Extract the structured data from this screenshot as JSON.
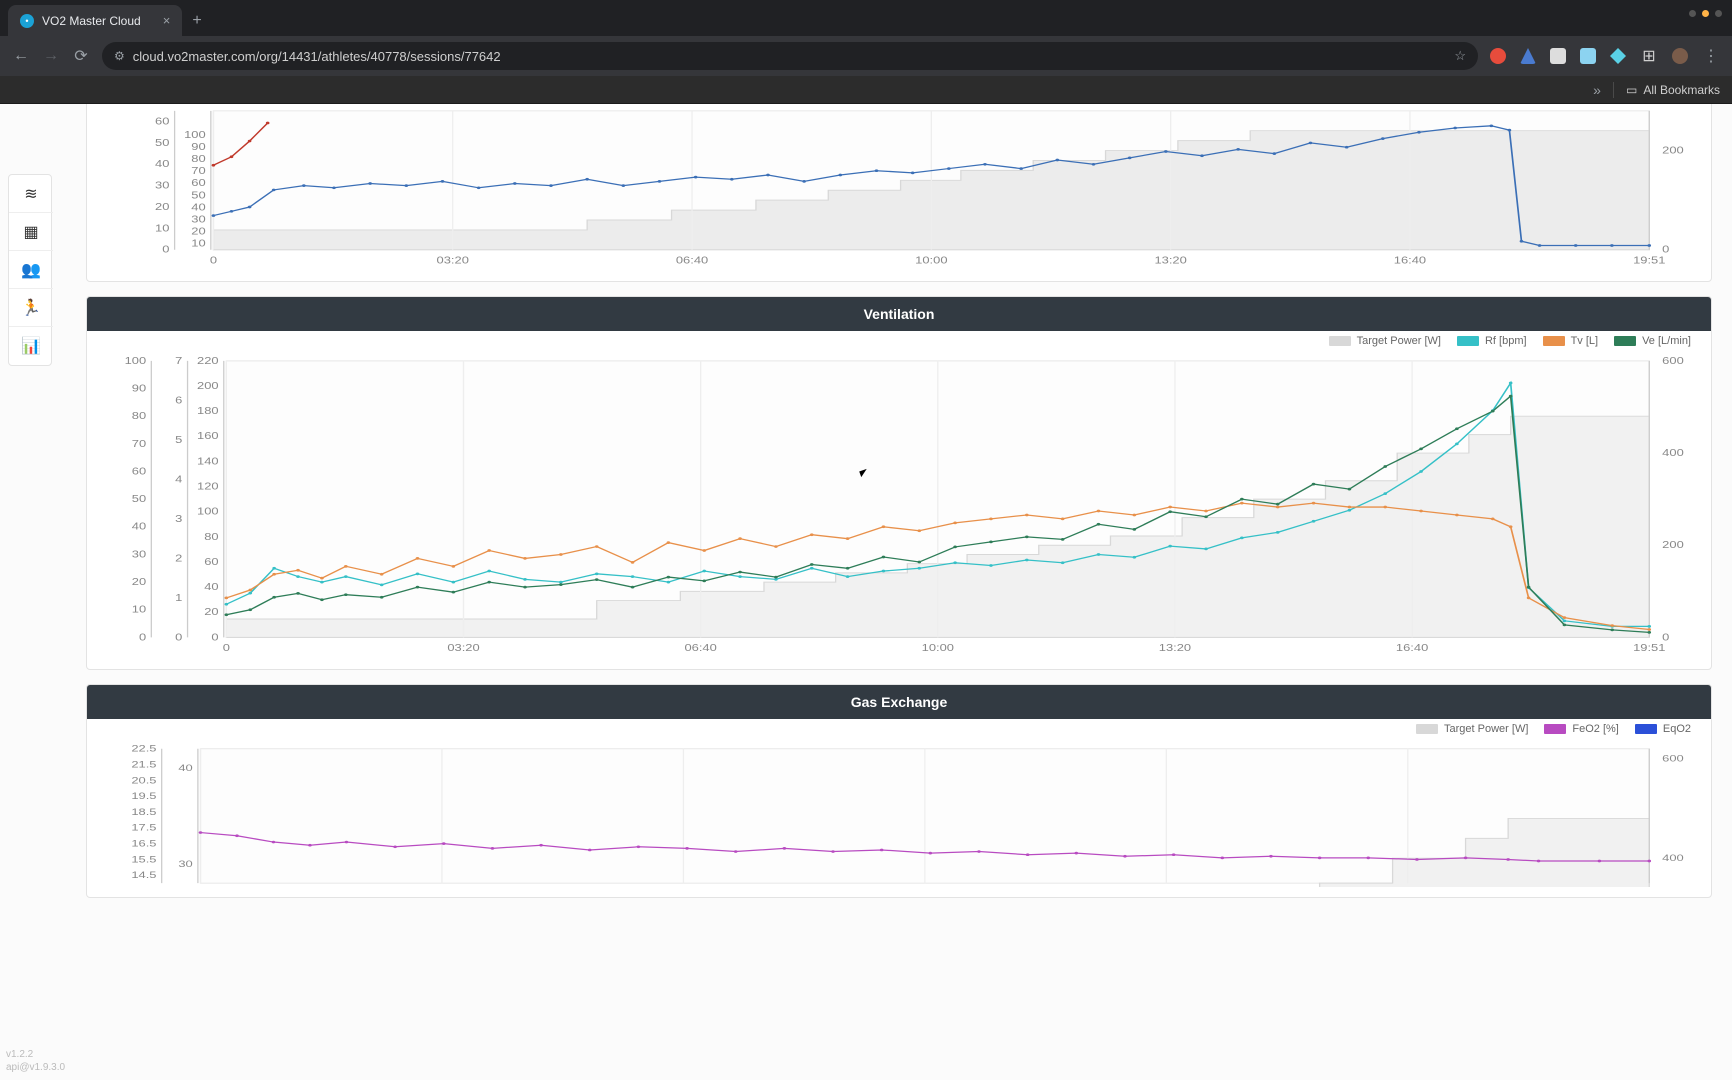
{
  "browser": {
    "tab_title": "VO2 Master Cloud",
    "url": "cloud.vo2master.com/org/14431/athletes/40778/sessions/77642",
    "bookmarks_label": "All Bookmarks"
  },
  "version": {
    "app": "v1.2.2",
    "api": "api@v1.9.3.0"
  },
  "sidebar_icons": [
    "layers",
    "grid",
    "group",
    "runner",
    "chart"
  ],
  "panels": [
    {
      "id": "top_cropped",
      "title": "",
      "legend": []
    },
    {
      "id": "ventilation",
      "title": "Ventilation",
      "legend": [
        {
          "label": "Target Power [W]",
          "color": "#d8d8d8"
        },
        {
          "label": "Rf [bpm]",
          "color": "#35c0c7"
        },
        {
          "label": "Tv [L]",
          "color": "#e8904a"
        },
        {
          "label": "Ve [L/min]",
          "color": "#2e7d58"
        }
      ]
    },
    {
      "id": "gas_exchange",
      "title": "Gas Exchange",
      "legend": [
        {
          "label": "Target Power [W]",
          "color": "#d8d8d8"
        },
        {
          "label": "FeO2 [%]",
          "color": "#b84bc1"
        },
        {
          "label": "EqO2",
          "color": "#2b50d8"
        }
      ]
    }
  ],
  "chart_data": [
    {
      "id": "top_cropped",
      "type": "line",
      "x_ticks": [
        "0",
        "03:20",
        "06:40",
        "10:00",
        "13:20",
        "16:40",
        "19:51"
      ],
      "x_range": [
        0,
        1191
      ],
      "axes": [
        {
          "side": "left",
          "color": "#c0392b",
          "ticks": [
            10,
            20,
            30,
            40,
            50,
            60,
            70,
            80,
            90,
            100
          ],
          "lim": [
            0,
            120
          ],
          "visible_lim": [
            5,
            120
          ]
        },
        {
          "side": "left2",
          "color": "#3b6fb6",
          "ticks": [
            0,
            10,
            20,
            30,
            40,
            50,
            60
          ],
          "lim": [
            0,
            70
          ],
          "visible_lim": [
            0,
            65
          ]
        },
        {
          "side": "right",
          "color": "#666",
          "ticks": [
            0,
            200
          ],
          "lim": [
            0,
            600
          ],
          "visible_lim": [
            0,
            280
          ]
        }
      ],
      "target_power": {
        "color": "#d8d8d8",
        "fill": "#ececec",
        "steps_x": [
          0,
          200,
          310,
          380,
          450,
          510,
          570,
          620,
          680,
          740,
          800,
          860,
          1080,
          1191
        ],
        "steps_y": [
          40,
          40,
          60,
          80,
          100,
          120,
          140,
          160,
          180,
          200,
          220,
          240,
          240,
          0
        ]
      },
      "series": [
        {
          "name": "red-partial",
          "axis": 0,
          "color": "#c0392b",
          "x": [
            0,
            15,
            30,
            45
          ],
          "y": [
            75,
            82,
            95,
            110
          ]
        },
        {
          "name": "blue",
          "axis": 1,
          "color": "#3b6fb6",
          "x": [
            0,
            15,
            30,
            50,
            75,
            100,
            130,
            160,
            190,
            220,
            250,
            280,
            310,
            340,
            370,
            400,
            430,
            460,
            490,
            520,
            550,
            580,
            610,
            640,
            670,
            700,
            730,
            760,
            790,
            820,
            850,
            880,
            910,
            940,
            970,
            1000,
            1030,
            1060,
            1075,
            1085,
            1100,
            1130,
            1160,
            1191
          ],
          "y": [
            16,
            18,
            20,
            28,
            30,
            29,
            31,
            30,
            32,
            29,
            31,
            30,
            33,
            30,
            32,
            34,
            33,
            35,
            32,
            35,
            37,
            36,
            38,
            40,
            38,
            42,
            40,
            43,
            46,
            44,
            47,
            45,
            50,
            48,
            52,
            55,
            57,
            58,
            56,
            4,
            2,
            2,
            2,
            2
          ]
        }
      ]
    },
    {
      "id": "ventilation",
      "type": "line",
      "x_ticks": [
        "0",
        "03:20",
        "06:40",
        "10:00",
        "13:20",
        "16:40",
        "19:51"
      ],
      "x_range": [
        0,
        1191
      ],
      "axes": [
        {
          "side": "left",
          "label": "",
          "color": "#2e7d58",
          "ticks": [
            0,
            20,
            40,
            60,
            80,
            100,
            120,
            140,
            160,
            180,
            200,
            220
          ],
          "lim": [
            0,
            220
          ]
        },
        {
          "side": "left2",
          "label": "",
          "color": "#e8904a",
          "ticks": [
            0,
            1,
            2,
            3,
            4,
            5,
            6,
            7
          ],
          "lim": [
            0,
            7
          ]
        },
        {
          "side": "left3",
          "label": "",
          "color": "#35c0c7",
          "ticks": [
            0,
            10,
            20,
            30,
            40,
            50,
            60,
            70,
            80,
            90,
            100
          ],
          "lim": [
            0,
            100
          ]
        },
        {
          "side": "right",
          "label": "",
          "color": "#666",
          "ticks": [
            0,
            200,
            400,
            600
          ],
          "lim": [
            0,
            600
          ]
        }
      ],
      "target_power": {
        "color": "#d8d8d8",
        "fill": "#f1f1f1",
        "steps_x": [
          0,
          200,
          310,
          380,
          450,
          510,
          570,
          620,
          680,
          740,
          800,
          860,
          920,
          980,
          1040,
          1075,
          1191
        ],
        "steps_y": [
          40,
          40,
          80,
          100,
          120,
          140,
          160,
          180,
          200,
          220,
          260,
          300,
          340,
          400,
          440,
          480,
          60
        ]
      },
      "series": [
        {
          "name": "Rf [bpm]",
          "axis": 2,
          "color": "#35c0c7",
          "x": [
            0,
            20,
            40,
            60,
            80,
            100,
            130,
            160,
            190,
            220,
            250,
            280,
            310,
            340,
            370,
            400,
            430,
            460,
            490,
            520,
            550,
            580,
            610,
            640,
            670,
            700,
            730,
            760,
            790,
            820,
            850,
            880,
            910,
            940,
            970,
            1000,
            1030,
            1060,
            1075,
            1090,
            1120,
            1160,
            1191
          ],
          "y": [
            12,
            16,
            25,
            22,
            20,
            22,
            19,
            23,
            20,
            24,
            21,
            20,
            23,
            22,
            20,
            24,
            22,
            21,
            25,
            22,
            24,
            25,
            27,
            26,
            28,
            27,
            30,
            29,
            33,
            32,
            36,
            38,
            42,
            46,
            52,
            60,
            70,
            82,
            92,
            18,
            6,
            4,
            4
          ]
        },
        {
          "name": "Tv [L]",
          "axis": 1,
          "color": "#e8904a",
          "x": [
            0,
            20,
            40,
            60,
            80,
            100,
            130,
            160,
            190,
            220,
            250,
            280,
            310,
            340,
            370,
            400,
            430,
            460,
            490,
            520,
            550,
            580,
            610,
            640,
            670,
            700,
            730,
            760,
            790,
            820,
            850,
            880,
            910,
            940,
            970,
            1000,
            1030,
            1060,
            1075,
            1090,
            1120,
            1160,
            1191
          ],
          "y": [
            1.0,
            1.2,
            1.6,
            1.7,
            1.5,
            1.8,
            1.6,
            2.0,
            1.8,
            2.2,
            2.0,
            2.1,
            2.3,
            1.9,
            2.4,
            2.2,
            2.5,
            2.3,
            2.6,
            2.5,
            2.8,
            2.7,
            2.9,
            3.0,
            3.1,
            3.0,
            3.2,
            3.1,
            3.3,
            3.2,
            3.4,
            3.3,
            3.4,
            3.3,
            3.3,
            3.2,
            3.1,
            3.0,
            2.8,
            1.0,
            0.5,
            0.3,
            0.2
          ]
        },
        {
          "name": "Ve [L/min]",
          "axis": 0,
          "color": "#2e7d58",
          "x": [
            0,
            20,
            40,
            60,
            80,
            100,
            130,
            160,
            190,
            220,
            250,
            280,
            310,
            340,
            370,
            400,
            430,
            460,
            490,
            520,
            550,
            580,
            610,
            640,
            670,
            700,
            730,
            760,
            790,
            820,
            850,
            880,
            910,
            940,
            970,
            1000,
            1030,
            1060,
            1075,
            1090,
            1120,
            1160,
            1191
          ],
          "y": [
            18,
            22,
            32,
            35,
            30,
            34,
            32,
            40,
            36,
            44,
            40,
            42,
            46,
            40,
            48,
            45,
            52,
            48,
            58,
            55,
            64,
            60,
            72,
            76,
            80,
            78,
            90,
            86,
            100,
            96,
            110,
            106,
            122,
            118,
            136,
            150,
            166,
            180,
            192,
            40,
            10,
            6,
            4
          ]
        }
      ]
    },
    {
      "id": "gas_exchange",
      "type": "line",
      "x_ticks": [
        "0",
        "03:20",
        "06:40",
        "10:00",
        "13:20",
        "16:40",
        "19:51"
      ],
      "x_range": [
        0,
        1191
      ],
      "axes": [
        {
          "side": "left",
          "color": "#2b50d8",
          "ticks": [
            30,
            40
          ],
          "lim": [
            20,
            45
          ],
          "visible_lim": [
            28,
            42
          ]
        },
        {
          "side": "left2",
          "color": "#b84bc1",
          "ticks": [
            14.5,
            15.5,
            16.5,
            17.5,
            18.5,
            19.5,
            20.5,
            21.5,
            22.5
          ],
          "lim": [
            13.5,
            22.5
          ],
          "visible_lim": [
            14,
            22.5
          ]
        },
        {
          "side": "right",
          "color": "#666",
          "ticks": [
            400,
            600
          ],
          "lim": [
            0,
            600
          ],
          "visible_lim": [
            350,
            620
          ]
        }
      ],
      "target_power": {
        "color": "#d8d8d8",
        "fill": "#f1f1f1",
        "steps_x": [
          0,
          860,
          920,
          980,
          1040,
          1075,
          1191
        ],
        "steps_y": [
          0,
          0,
          350,
          400,
          440,
          480,
          60
        ]
      },
      "series": [
        {
          "name": "FeO2 [%]",
          "axis": 1,
          "color": "#b84bc1",
          "x": [
            0,
            30,
            60,
            90,
            120,
            160,
            200,
            240,
            280,
            320,
            360,
            400,
            440,
            480,
            520,
            560,
            600,
            640,
            680,
            720,
            760,
            800,
            840,
            880,
            920,
            960,
            1000,
            1040,
            1075,
            1100,
            1150,
            1191
          ],
          "y": [
            17.2,
            17.0,
            16.6,
            16.4,
            16.6,
            16.3,
            16.5,
            16.2,
            16.4,
            16.1,
            16.3,
            16.2,
            16.0,
            16.2,
            16.0,
            16.1,
            15.9,
            16.0,
            15.8,
            15.9,
            15.7,
            15.8,
            15.6,
            15.7,
            15.6,
            15.6,
            15.5,
            15.6,
            15.5,
            15.4,
            15.4,
            15.4
          ]
        }
      ]
    }
  ]
}
